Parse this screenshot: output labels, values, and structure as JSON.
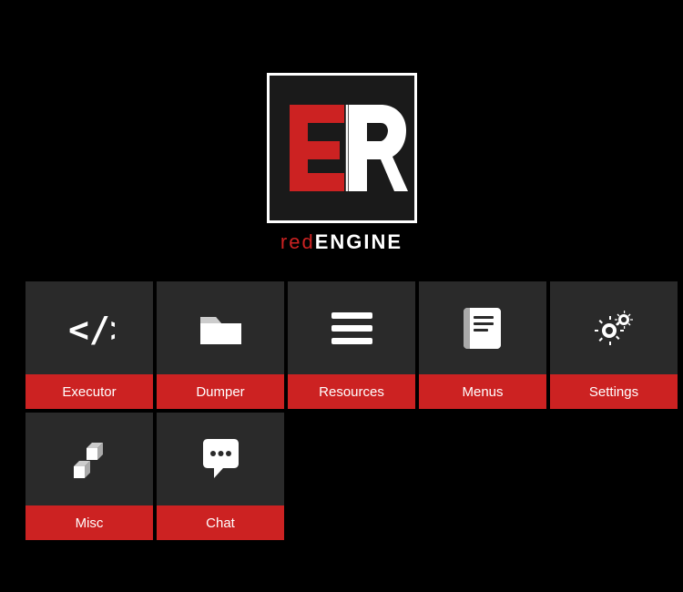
{
  "logo": {
    "text_red": "red",
    "text_bold": "ENGINE"
  },
  "grid": {
    "rows": [
      [
        {
          "id": "executor",
          "label": "Executor",
          "icon": "code"
        },
        {
          "id": "dumper",
          "label": "Dumper",
          "icon": "folder"
        },
        {
          "id": "resources",
          "label": "Resources",
          "icon": "list"
        },
        {
          "id": "menus",
          "label": "Menus",
          "icon": "book"
        },
        {
          "id": "settings",
          "label": "Settings",
          "icon": "gear"
        }
      ],
      [
        {
          "id": "misc",
          "label": "Misc",
          "icon": "blocks"
        },
        {
          "id": "chat",
          "label": "Chat",
          "icon": "chat"
        }
      ]
    ]
  }
}
